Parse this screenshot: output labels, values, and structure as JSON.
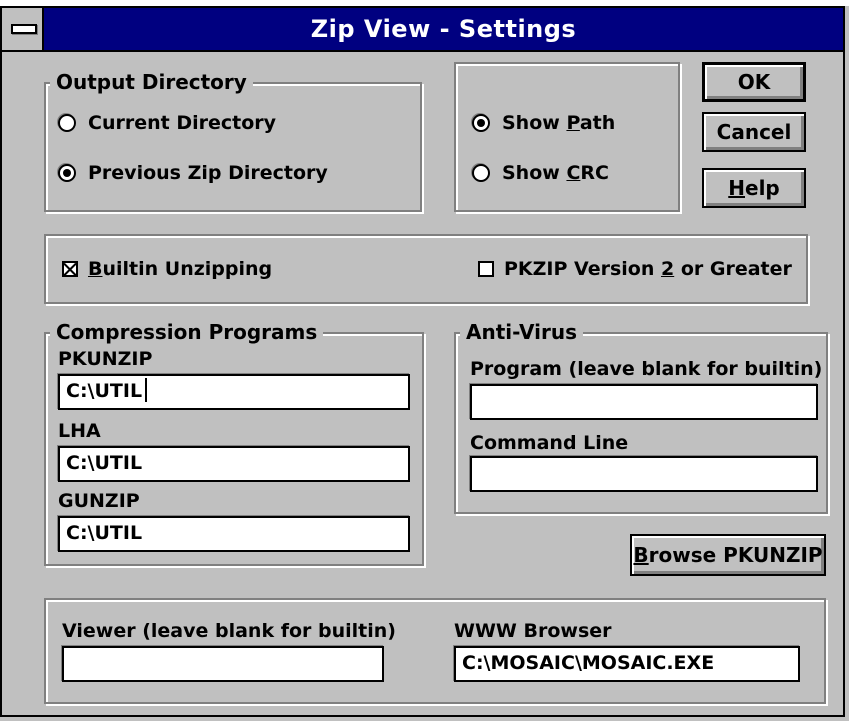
{
  "window": {
    "title": "Zip View - Settings"
  },
  "output_directory": {
    "legend": "Output Directory",
    "current_label": "Current Directory",
    "previous_label": "Previous Zip Directory",
    "selected": "Previous Zip Directory"
  },
  "display": {
    "show_path": {
      "pre": "Show ",
      "key": "P",
      "post": "ath",
      "selected": true
    },
    "show_crc": {
      "pre": "Show ",
      "key": "C",
      "post": "RC",
      "selected": false
    }
  },
  "buttons": {
    "ok": "OK",
    "cancel": "Cancel",
    "help": {
      "key": "H",
      "post": "elp"
    },
    "browse": {
      "key": "B",
      "post": "rowse PKUNZIP"
    }
  },
  "options": {
    "builtin_unzipping": {
      "key": "B",
      "post": "uiltin Unzipping",
      "checked": true
    },
    "pkzip_v2": {
      "pre": "PKZIP Version ",
      "key": "2",
      "post": " or Greater",
      "checked": false
    }
  },
  "compression": {
    "legend": "Compression Programs",
    "pkunzip": {
      "label": "PKUNZIP",
      "value": "C:\\UTIL"
    },
    "lha": {
      "label": "LHA",
      "value": "C:\\UTIL"
    },
    "gunzip": {
      "label": "GUNZIP",
      "value": "C:\\UTIL"
    }
  },
  "antivirus": {
    "legend": "Anti-Virus",
    "program_label": "Program (leave blank for builtin)",
    "program_value": "",
    "command_label": "Command Line",
    "command_value": ""
  },
  "viewer": {
    "viewer_label": "Viewer (leave blank for builtin)",
    "viewer_value": "",
    "browser_label": "WWW Browser",
    "browser_value": "C:\\MOSAIC\\MOSAIC.EXE"
  }
}
